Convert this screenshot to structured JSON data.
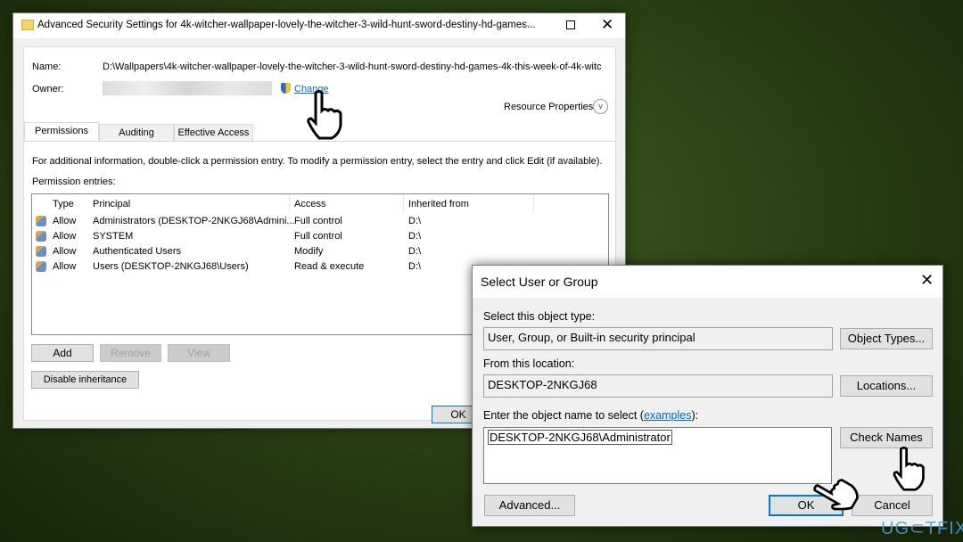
{
  "main_window": {
    "title": "Advanced Security Settings for 4k-witcher-wallpaper-lovely-the-witcher-3-wild-hunt-sword-destiny-hd-games...",
    "name_label": "Name:",
    "name_value": "D:\\Wallpapers\\4k-witcher-wallpaper-lovely-the-witcher-3-wild-hunt-sword-destiny-hd-games-4k-this-week-of-4k-witc",
    "owner_label": "Owner:",
    "change_link": "Change",
    "resource_properties": "Resource Properties",
    "tabs": [
      {
        "label": "Permissions",
        "active": true
      },
      {
        "label": "Auditing"
      },
      {
        "label": "Effective Access"
      }
    ],
    "info_text": "For additional information, double-click a permission entry. To modify a permission entry, select the entry and click Edit (if available).",
    "entries_label": "Permission entries:",
    "columns": [
      "Type",
      "Principal",
      "Access",
      "Inherited from"
    ],
    "rows": [
      [
        "Allow",
        "Administrators (DESKTOP-2NKGJ68\\Admini...",
        "Full control",
        "D:\\"
      ],
      [
        "Allow",
        "SYSTEM",
        "Full control",
        "D:\\"
      ],
      [
        "Allow",
        "Authenticated Users",
        "Modify",
        "D:\\"
      ],
      [
        "Allow",
        "Users (DESKTOP-2NKGJ68\\Users)",
        "Read & execute",
        "D:\\"
      ]
    ],
    "add": "Add",
    "remove": "Remove",
    "view": "View",
    "disable_inheritance": "Disable inheritance",
    "ok": "OK"
  },
  "dialog": {
    "title": "Select User or Group",
    "object_type_label": "Select this object type:",
    "object_type_value": "User, Group, or Built-in security principal",
    "object_types_btn": "Object Types...",
    "location_label": "From this location:",
    "location_value": "DESKTOP-2NKGJ68",
    "locations_btn": "Locations...",
    "enter_label_pre": "Enter the object name to select (",
    "examples_link": "examples",
    "enter_label_post": "):",
    "object_name_value": "DESKTOP-2NKGJ68\\Administrator",
    "check_names_btn": "Check Names",
    "advanced_btn": "Advanced...",
    "ok_btn": "OK",
    "cancel_btn": "Cancel"
  },
  "watermark": "UG⊂TFIX",
  "colors": {
    "link": "#0066cc",
    "focus": "#0078d7"
  }
}
